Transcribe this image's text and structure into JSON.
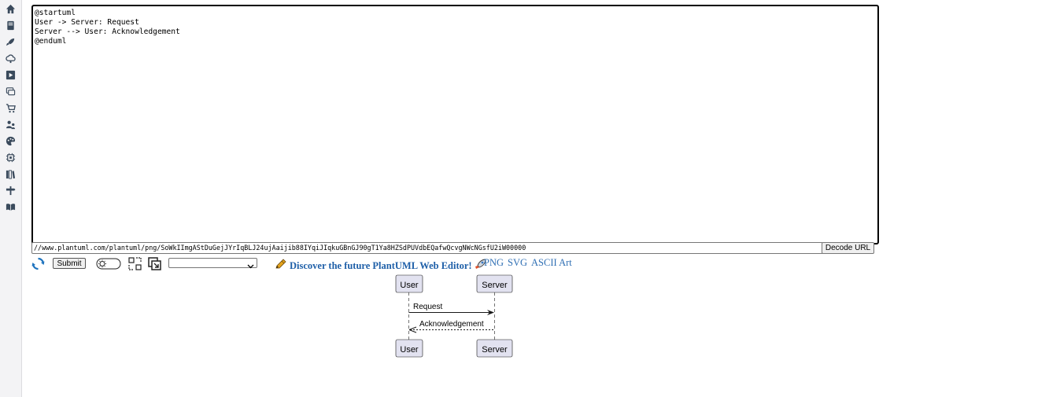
{
  "sidebar": {
    "icons": [
      "home-icon",
      "book-icon",
      "rocket-icon",
      "cloud-icon",
      "play-icon",
      "chat-icon",
      "cart-icon",
      "users-icon",
      "palette-icon",
      "chip-icon",
      "library-icon",
      "signpost-icon",
      "reading-icon"
    ]
  },
  "editor": {
    "lines": [
      "@startuml",
      "User -> Server: Request",
      "Server --> User: Acknowledgement",
      "@enduml"
    ]
  },
  "url_bar": {
    "value": "//www.plantuml.com/plantuml/png/SoWkIImgAStDuGejJYrIqBLJ24ujAaijib88IYqiJIqkuGBnGJ90gT1Ya8HZSdPUVdbEQafwQcvgNWcNGsfU2iW00000",
    "decode_label": "Decode URL"
  },
  "toolbar": {
    "submit_label": "Submit",
    "select_value": "",
    "promo_text": "Discover the future PlantUML Web Editor!",
    "formats": [
      "PNG",
      "SVG",
      "ASCII Art"
    ]
  },
  "diagram": {
    "participants": [
      "User",
      "Server"
    ],
    "messages": [
      "Request",
      "Acknowledgement"
    ]
  },
  "colors": {
    "participant_fill": "#e2e2f0",
    "participant_border": "#181818",
    "link": "#2f6fb4",
    "promo": "#1e5fa8"
  }
}
